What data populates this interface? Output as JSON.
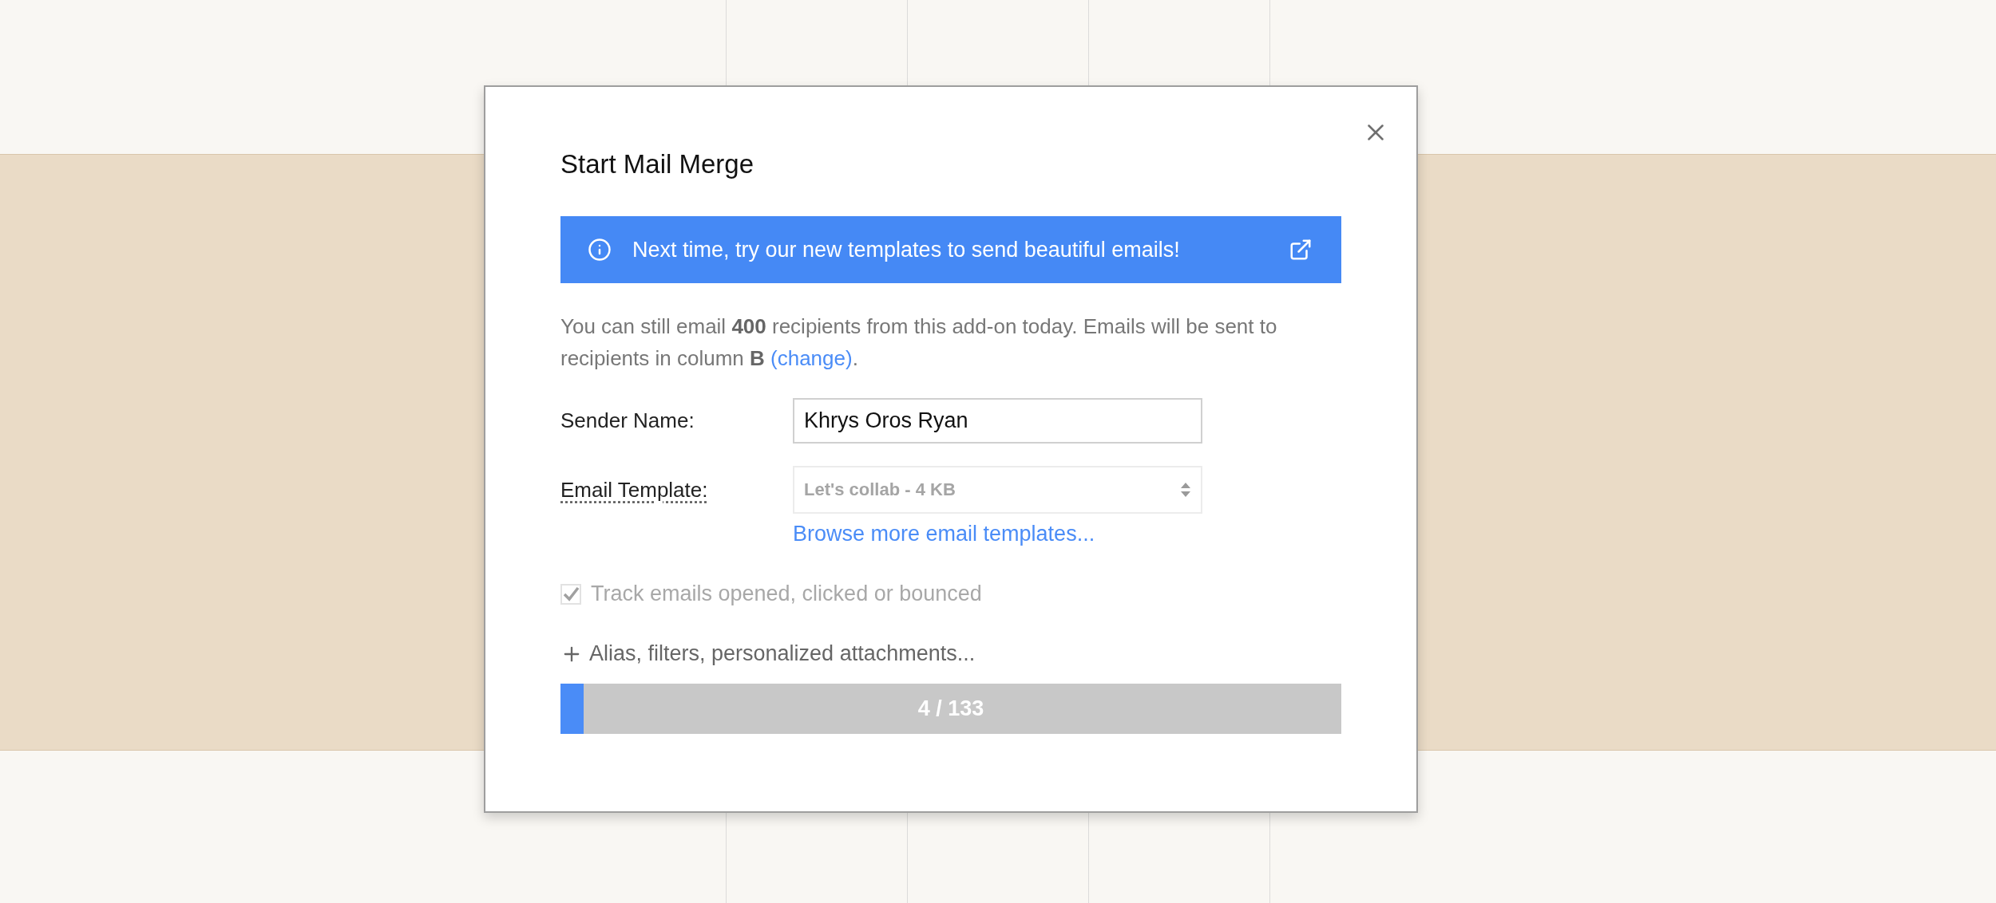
{
  "dialog": {
    "title": "Start Mail Merge",
    "banner": {
      "text": "Next time, try our new templates to send beautiful emails!"
    },
    "intro": {
      "text": "You can still email **400** recipients from this add-on today. Emails will be sent to recipients in column **B**",
      "link": "(change)",
      "end": "."
    },
    "sender": {
      "label": "Sender Name:",
      "value": "Khrys Oros Ryan"
    },
    "template": {
      "label": "Email Template:",
      "value": "Let's collab - 4 KB",
      "disabled": true
    },
    "browse_link": "Browse more email templates...",
    "track": {
      "label": "Track emails opened, clicked or bounced",
      "checked": true,
      "disabled": true
    },
    "more_options": "Alias, filters, personalized attachments...",
    "progress": {
      "level": 0.03,
      "reading": "4 / 133"
    }
  }
}
